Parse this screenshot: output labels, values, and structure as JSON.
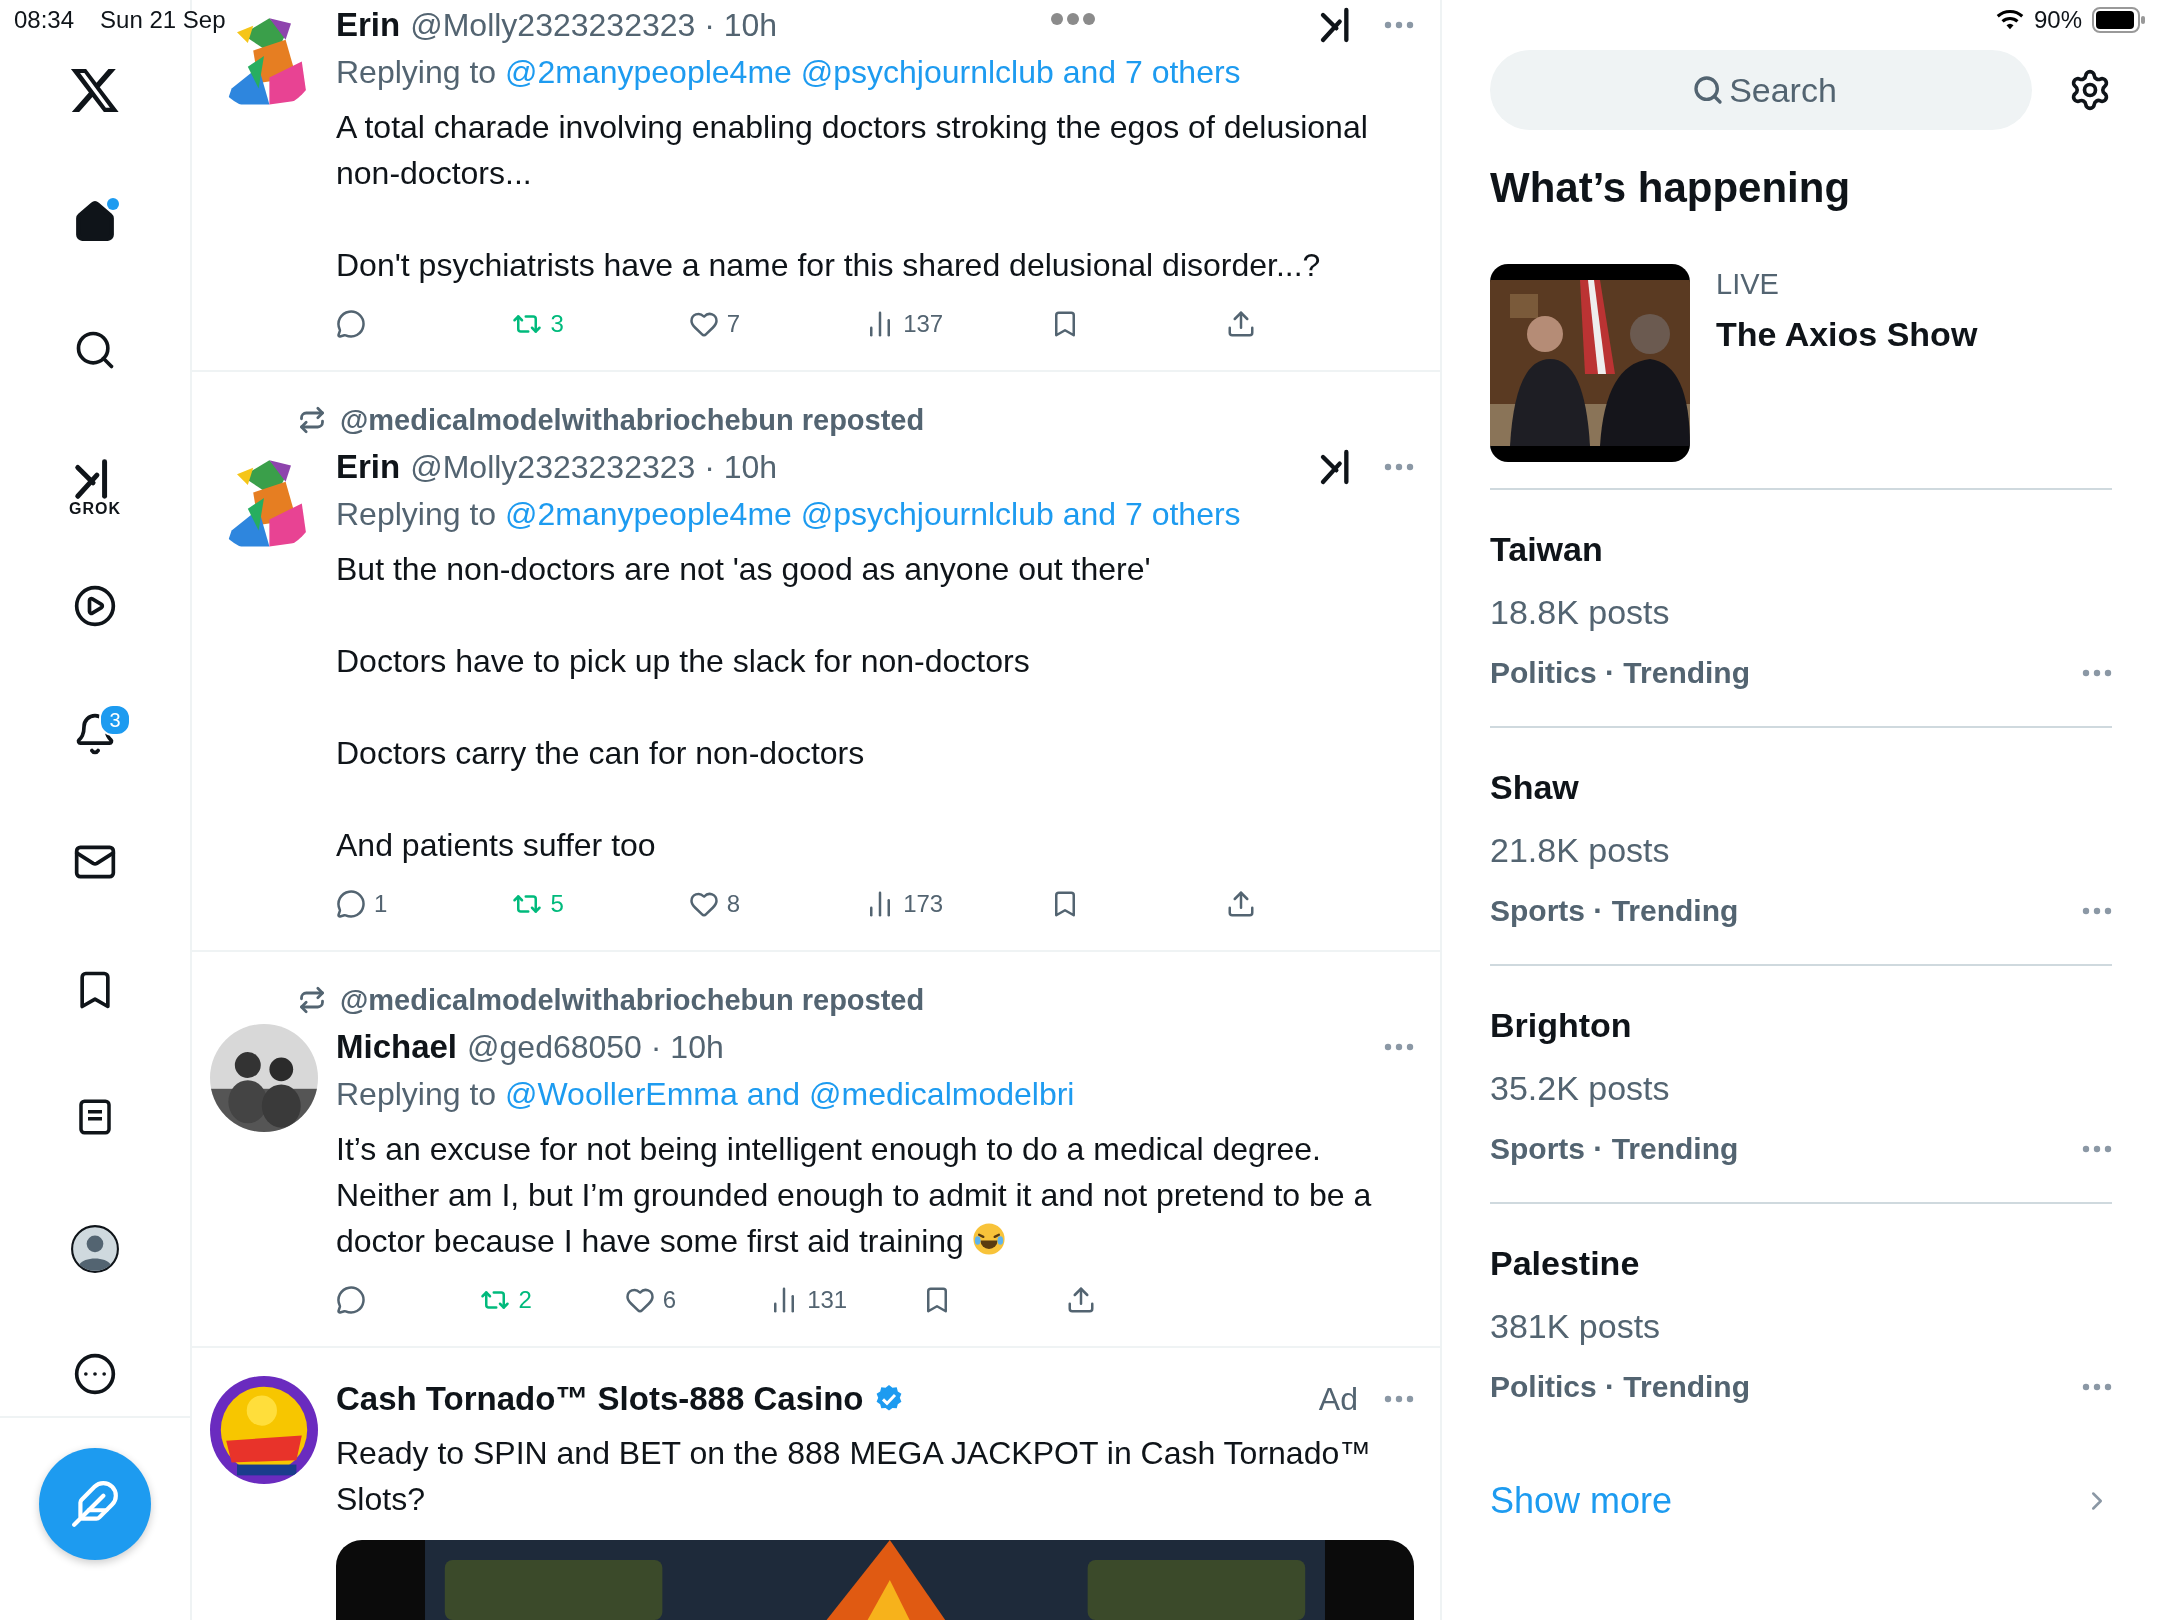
{
  "status_bar": {
    "time": "08:34",
    "date": "Sun 21 Sep",
    "battery": "90%"
  },
  "sidebar": {
    "items": [
      {
        "kind": "home",
        "selected": true,
        "unread_dot": true
      },
      {
        "kind": "search",
        "selected": false
      },
      {
        "kind": "grok",
        "label": "GROK",
        "selected": false
      },
      {
        "kind": "video",
        "selected": false
      },
      {
        "kind": "notifications",
        "selected": false,
        "badge": "3"
      },
      {
        "kind": "messages",
        "selected": false
      },
      {
        "kind": "bookmarks",
        "selected": false
      },
      {
        "kind": "lists",
        "selected": false
      },
      {
        "kind": "profile",
        "selected": false
      },
      {
        "kind": "more",
        "selected": false
      }
    ]
  },
  "feed": {
    "posts": [
      {
        "kind": "post",
        "name": "Erin",
        "meta": "@Molly2323232323 · 10h",
        "grok_button": true,
        "replying_label": "Replying to",
        "mentions": "@2manypeople4me @psychjournlclub and 7 others",
        "body": [
          "A total charade involving enabling doctors stroking the egos of delusional non-doctors...",
          "Don't psychiatrists have a name for this shared delusional disorder...?"
        ],
        "reposted": true,
        "actions": [
          {
            "kind": "reply"
          },
          {
            "kind": "repost",
            "count": "3"
          },
          {
            "kind": "like",
            "count": "7"
          },
          {
            "kind": "views",
            "count": "137"
          },
          {
            "kind": "bookmark"
          },
          {
            "kind": "share"
          }
        ]
      },
      {
        "kind": "post",
        "repost_header": "@medicalmodelwithabriochebun reposted",
        "name": "Erin",
        "meta": "@Molly2323232323 · 10h",
        "grok_button": true,
        "replying_label": "Replying to",
        "mentions": "@2manypeople4me @psychjournlclub and 7 others",
        "body": [
          "But the non-doctors are not 'as good as anyone out there'",
          "Doctors have to pick up the slack for non-doctors",
          "Doctors carry the can for non-doctors",
          "And patients suffer too"
        ],
        "reposted": true,
        "actions": [
          {
            "kind": "reply",
            "count": "1"
          },
          {
            "kind": "repost",
            "count": "5"
          },
          {
            "kind": "like",
            "count": "8"
          },
          {
            "kind": "views",
            "count": "173"
          },
          {
            "kind": "bookmark"
          },
          {
            "kind": "share"
          }
        ]
      },
      {
        "kind": "post",
        "repost_header": "@medicalmodelwithabriochebun reposted",
        "name": "Michael",
        "meta": "@ged68050 · 10h",
        "grok_button": false,
        "replying_label": "Replying to",
        "mentions": "@WoollerEmma and @medicalmodelbri",
        "body": [
          "It’s an excuse for not being intelligent enough to do a medical degree. Neither am I, but I’m grounded enough to admit it and not pretend to be a doctor because I have some first aid training"
        ],
        "ends_with_emoji": true,
        "reposted": true,
        "actions": [
          {
            "kind": "reply"
          },
          {
            "kind": "repost",
            "count": "2"
          },
          {
            "kind": "like",
            "count": "6"
          },
          {
            "kind": "views",
            "count": "131"
          },
          {
            "kind": "bookmark"
          },
          {
            "kind": "share"
          }
        ]
      },
      {
        "kind": "ad",
        "name": "Cash Tornado™ Slots-888 Casino",
        "verified": true,
        "ad_label": "Ad",
        "body": [
          "Ready to SPIN and BET on the 888 MEGA JACKPOT in Cash Tornado™ Slots?"
        ]
      }
    ]
  },
  "right_panel": {
    "search": {
      "placeholder": "Search"
    },
    "heading": "What’s happening",
    "live": {
      "label": "LIVE",
      "title": "The Axios Show"
    },
    "trends": [
      {
        "name": "Taiwan",
        "posts": "18.8K posts",
        "category": "Politics · Trending"
      },
      {
        "name": "Shaw",
        "posts": "21.8K posts",
        "category": "Sports · Trending"
      },
      {
        "name": "Brighton",
        "posts": "35.2K posts",
        "category": "Sports · Trending"
      },
      {
        "name": "Palestine",
        "posts": "381K posts",
        "category": "Politics · Trending"
      }
    ],
    "show_more": "Show more"
  }
}
